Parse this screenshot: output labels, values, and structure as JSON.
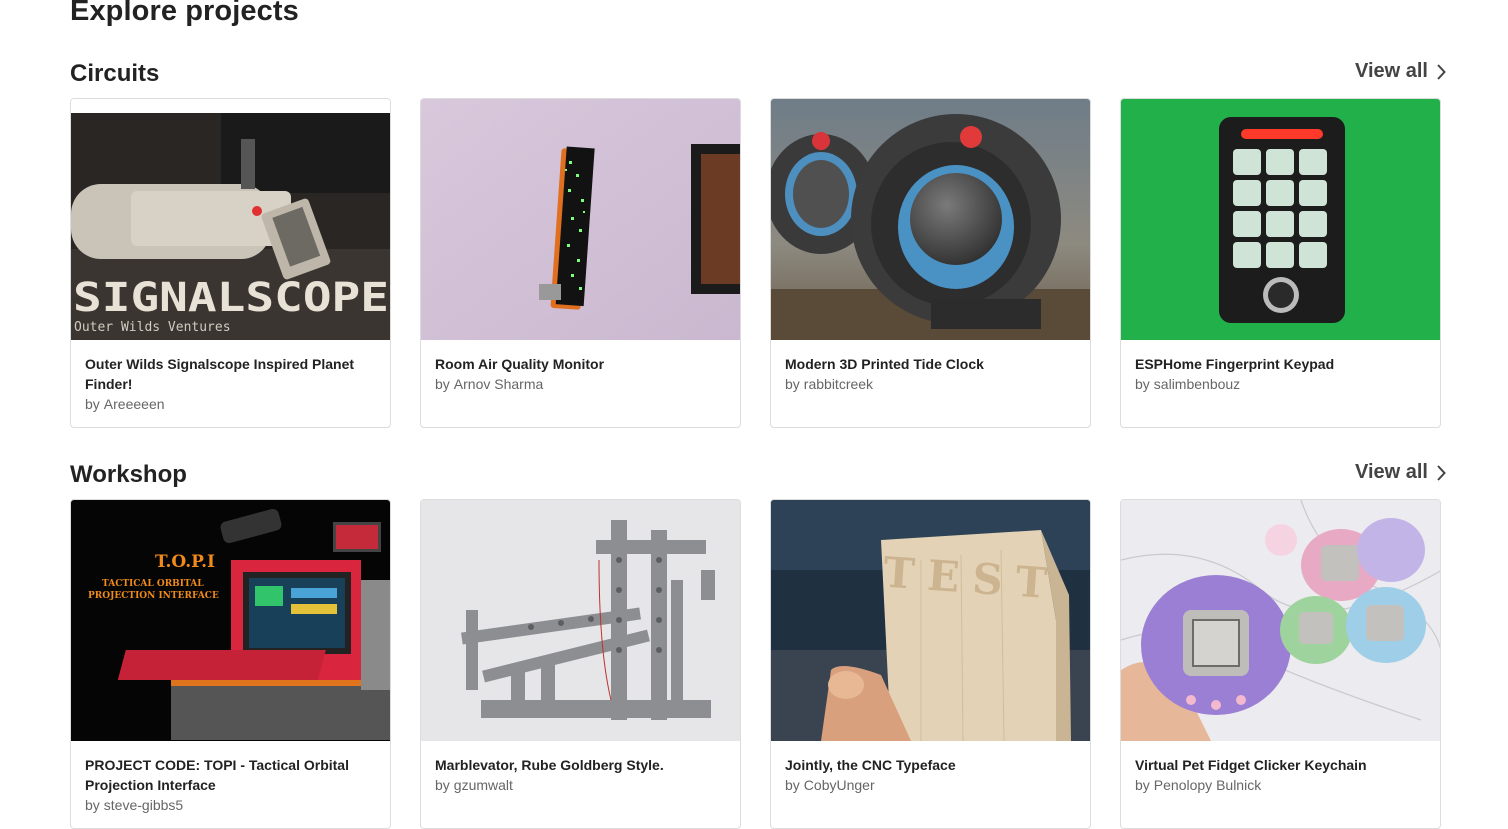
{
  "page": {
    "title": "Explore projects"
  },
  "sections": [
    {
      "title": "Circuits",
      "view_all": "View all",
      "cards": [
        {
          "title": "Outer Wilds Signalscope Inspired Planet Finder!",
          "by": "by",
          "author": "Areeeeen",
          "image_text": "SIGNALSCOPE",
          "image_subtext": "Outer Wilds Ventures"
        },
        {
          "title": "Room Air Quality Monitor",
          "by": "by",
          "author": "Arnov Sharma"
        },
        {
          "title": "Modern 3D Printed Tide Clock",
          "by": "by",
          "author": "rabbitcreek"
        },
        {
          "title": "ESPHome Fingerprint Keypad",
          "by": "by",
          "author": "salimbenbouz"
        }
      ]
    },
    {
      "title": "Workshop",
      "view_all": "View all",
      "cards": [
        {
          "title": "PROJECT CODE: TOPI - Tactical Orbital Projection Interface",
          "by": "by",
          "author": "steve-gibbs5",
          "image_text": "T.O.P.I",
          "image_subtext": "TACTICAL ORBITAL",
          "image_subtext2": "PROJECTION INTERFACE"
        },
        {
          "title": "Marblevator, Rube Goldberg Style.",
          "by": "by",
          "author": "gzumwalt"
        },
        {
          "title": "Jointly, the CNC Typeface",
          "by": "by",
          "author": "CobyUnger",
          "image_text": "TEST"
        },
        {
          "title": "Virtual Pet Fidget Clicker Keychain",
          "by": "by",
          "author": "Penolopy Bulnick"
        }
      ]
    }
  ]
}
